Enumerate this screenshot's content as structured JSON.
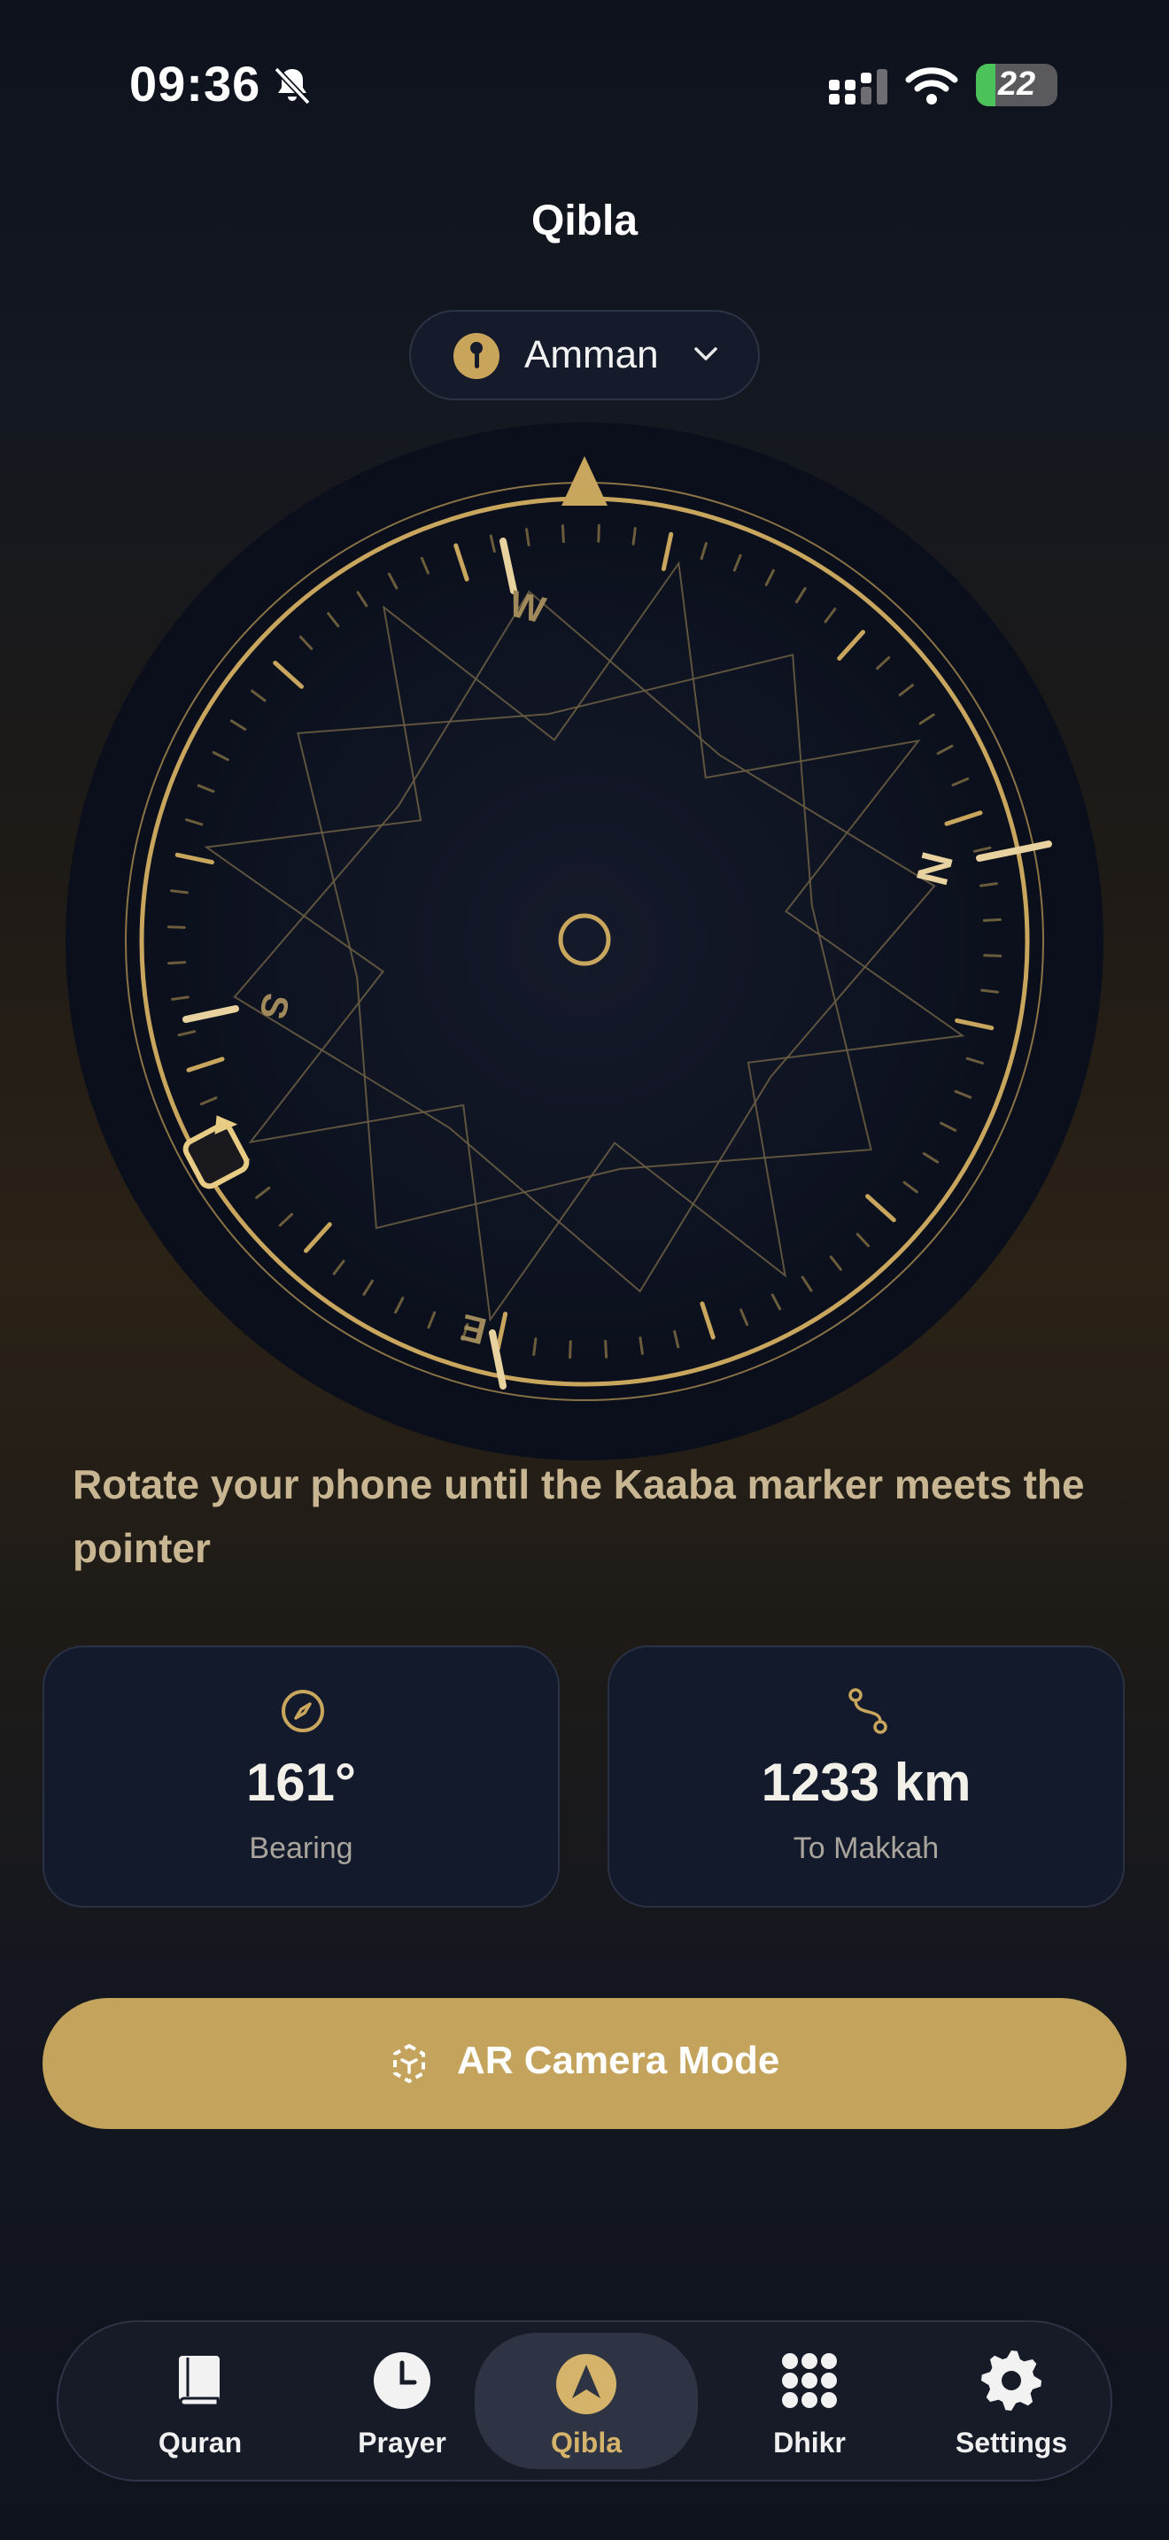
{
  "status_bar": {
    "time": "09:36",
    "battery": "22",
    "icons": [
      "bell-slash-icon",
      "cellular-signal-icon",
      "wifi-icon",
      "battery-charging-icon"
    ]
  },
  "header": {
    "title": "Qibla"
  },
  "location": {
    "name": "Amman",
    "icon": "location-pin-icon",
    "dropdown_icon": "chevron-down-icon"
  },
  "compass": {
    "cardinals": {
      "north": "N",
      "east": "E",
      "south": "S",
      "west": "W"
    },
    "markers": [
      "qibla-pointer-icon",
      "kaaba-marker-icon"
    ]
  },
  "instruction": "Rotate your phone until the Kaaba marker meets the pointer",
  "stats": {
    "bearing": {
      "value": "161°",
      "label": "Bearing",
      "icon": "compass-icon"
    },
    "distance": {
      "value": "1233 km",
      "label": "To Makkah",
      "icon": "route-icon"
    }
  },
  "ar_button": {
    "label": "AR Camera Mode",
    "icon": "ar-cube-icon"
  },
  "tabs": [
    {
      "label": "Quran",
      "icon": "book-icon",
      "active": false
    },
    {
      "label": "Prayer",
      "icon": "clock-icon",
      "active": false
    },
    {
      "label": "Qibla",
      "icon": "navigation-arrow-icon",
      "active": true
    },
    {
      "label": "Dhikr",
      "icon": "dots-grid-icon",
      "active": false
    },
    {
      "label": "Settings",
      "icon": "gear-icon",
      "active": false
    }
  ],
  "colors": {
    "gold": "#c4a45c",
    "gold_light": "#d9bc7a",
    "navy": "#131a2c",
    "background": "#0e121d"
  }
}
